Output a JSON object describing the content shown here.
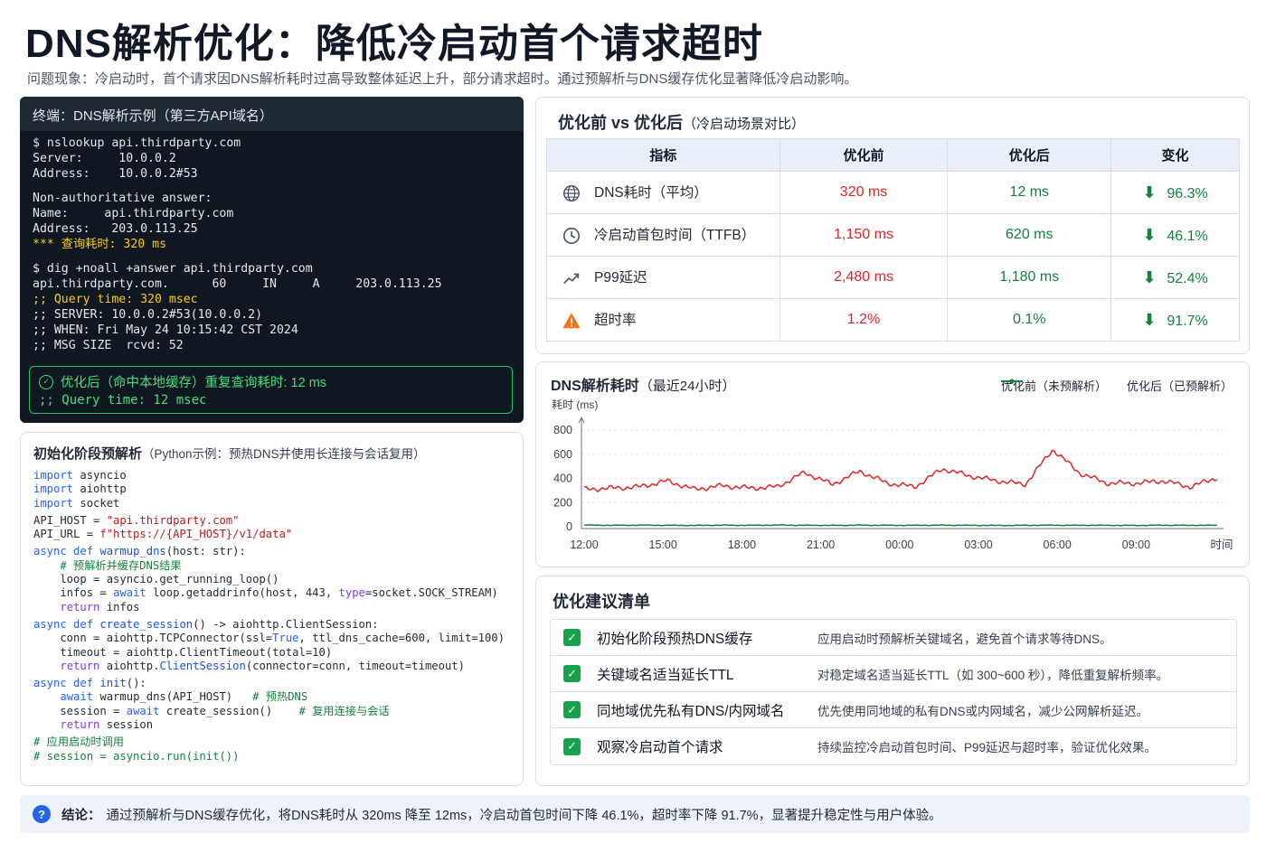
{
  "header": {
    "title": "DNS解析优化：降低冷启动首个请求超时",
    "subtitle": "问题现象：冷启动时，首个请求因DNS解析耗时过高导致整体延迟上升，部分请求超时。通过预解析与DNS缓存优化显著降低冷启动影响。"
  },
  "terminal": {
    "title": "终端：DNS解析示例（第三方API域名）",
    "lines": [
      "$ nslookup api.thirdparty.com",
      "Server:     10.0.0.2",
      "Address:    10.0.0.2#53",
      "",
      "Non-authoritative answer:",
      "Name:     api.thirdparty.com",
      "Address:   203.0.113.25",
      "*** 查询耗时: 320 ms",
      "",
      "$ dig +noall +answer api.thirdparty.com",
      "api.thirdparty.com.      60     IN     A     203.0.113.25",
      ";; Query time: 320 msec",
      ";; SERVER: 10.0.0.2#53(10.0.0.2)",
      ";; WHEN: Fri May 24 10:15:42 CST 2024",
      ";; MSG SIZE  rcvd: 52"
    ],
    "box_line1": "优化后（命中本地缓存）重复查询耗时: 12 ms",
    "box_line2": ";; Query time: 12 msec"
  },
  "code": {
    "title": "初始化阶段预解析",
    "subtitle": "（Python示例：预热DNS并使用长连接与会话复用）"
  },
  "comparison": {
    "title": "优化前 vs 优化后",
    "subtitle": "（冷启动场景对比）",
    "headers": [
      "指标",
      "优化前",
      "优化后",
      "变化"
    ],
    "rows": [
      {
        "icon": "globe-icon",
        "name": "DNS耗时（平均）",
        "before": "320 ms",
        "after": "12 ms",
        "change": "96.3%"
      },
      {
        "icon": "clock-icon",
        "name": "冷启动首包时间（TTFB）",
        "before": "1,150 ms",
        "after": "620 ms",
        "change": "46.1%"
      },
      {
        "icon": "trend-icon",
        "name": "P99延迟",
        "before": "2,480 ms",
        "after": "1,180 ms",
        "change": "52.4%"
      },
      {
        "icon": "warning-icon",
        "name": "超时率",
        "before": "1.2%",
        "after": "0.1%",
        "change": "91.7%"
      }
    ],
    "colors": {
      "before": "#dc2626",
      "after": "#15803d"
    }
  },
  "chart_data": {
    "type": "line",
    "title": "DNS解析耗时",
    "subtitle": "（最近24小时）",
    "ylabel": "耗时 (ms)",
    "xlabel": "时间",
    "ylim": [
      0,
      800
    ],
    "yticks": [
      0,
      200,
      400,
      600,
      800
    ],
    "xticks": [
      "12:00",
      "15:00",
      "18:00",
      "21:00",
      "00:00",
      "03:00",
      "06:00",
      "09:00"
    ],
    "grid": "horizontal dashed",
    "legend_position": "top-right",
    "series": [
      {
        "name": "优化前（未预解析）",
        "color": "#dc2626",
        "x": [
          "12:00",
          "13:00",
          "14:00",
          "15:00",
          "16:00",
          "17:00",
          "18:00",
          "19:00",
          "20:00",
          "21:00",
          "22:00",
          "23:00",
          "00:00",
          "01:00",
          "02:00",
          "03:00",
          "04:00",
          "05:00",
          "06:00",
          "07:00",
          "08:00",
          "09:00",
          "10:00",
          "11:00"
        ],
        "values": [
          310,
          320,
          330,
          380,
          310,
          340,
          320,
          330,
          450,
          350,
          460,
          360,
          330,
          480,
          420,
          380,
          350,
          640,
          440,
          360,
          360,
          380,
          330,
          410
        ]
      },
      {
        "name": "优化后（已预解析）",
        "color": "#15803d",
        "x": [
          "12:00",
          "13:00",
          "14:00",
          "15:00",
          "16:00",
          "17:00",
          "18:00",
          "19:00",
          "20:00",
          "21:00",
          "22:00",
          "23:00",
          "00:00",
          "01:00",
          "02:00",
          "03:00",
          "04:00",
          "05:00",
          "06:00",
          "07:00",
          "08:00",
          "09:00",
          "10:00",
          "11:00"
        ],
        "values": [
          14,
          12,
          13,
          12,
          11,
          13,
          12,
          14,
          12,
          11,
          13,
          12,
          12,
          13,
          12,
          11,
          12,
          13,
          12,
          12,
          11,
          13,
          12,
          12
        ]
      }
    ]
  },
  "recommendations": {
    "title": "优化建议清单",
    "items": [
      {
        "name": "初始化阶段预热DNS缓存",
        "desc": "应用启动时预解析关键域名，避免首个请求等待DNS。"
      },
      {
        "name": "关键域名适当延长TTL",
        "desc": "对稳定域名适当延长TTL（如 300~600 秒），降低重复解析频率。"
      },
      {
        "name": "同地域优先私有DNS/内网域名",
        "desc": "优先使用同地域的私有DNS或内网域名，减少公网解析延迟。"
      },
      {
        "name": "观察冷启动首个请求",
        "desc": "持续监控冷启动首包时间、P99延迟与超时率，验证优化效果。"
      }
    ]
  },
  "conclusion": {
    "label": "结论：",
    "text": "通过预解析与DNS缓存优化，将DNS耗时从 320ms 降至 12ms，冷启动首包时间下降 46.1%，超时率下降 91.7%，显著提升稳定性与用户体验。"
  }
}
